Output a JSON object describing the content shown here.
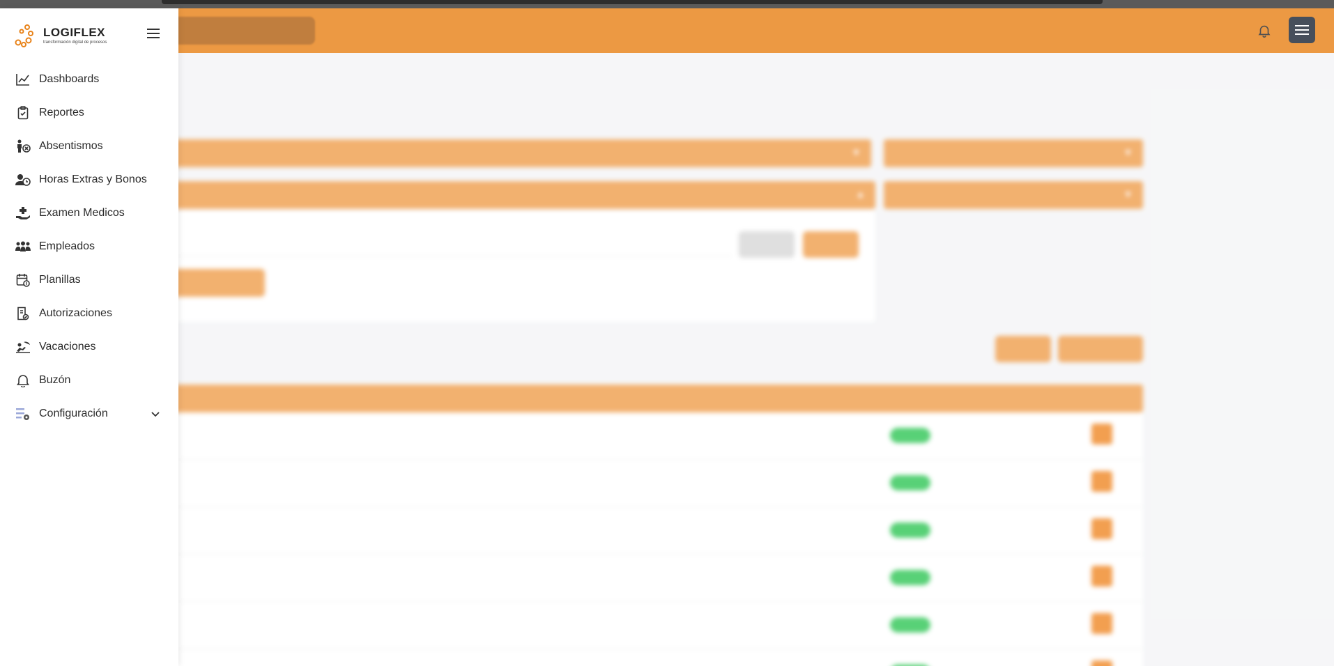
{
  "app": {
    "brand_name": "LOGIFLEX",
    "brand_tagline": "transformación digital de procesos"
  },
  "sidebar": {
    "items": [
      {
        "label": "Dashboards",
        "icon": "chart-line-icon"
      },
      {
        "label": "Reportes",
        "icon": "clipboard-icon"
      },
      {
        "label": "Absentismos",
        "icon": "person-x-icon"
      },
      {
        "label": "Horas Extras y Bonos",
        "icon": "user-clock-icon"
      },
      {
        "label": "Examen Medicos",
        "icon": "medical-hand-icon"
      },
      {
        "label": "Empleados",
        "icon": "people-icon"
      },
      {
        "label": "Planillas",
        "icon": "calendar-money-icon"
      },
      {
        "label": "Autorizaciones",
        "icon": "document-check-icon"
      },
      {
        "label": "Vacaciones",
        "icon": "beach-icon"
      },
      {
        "label": "Buzón",
        "icon": "bell-icon"
      },
      {
        "label": "Configuración",
        "icon": "settings-list-icon"
      }
    ]
  },
  "colors": {
    "header": "#e8831a",
    "accent": "#f0a050",
    "active_status": "#34c759"
  }
}
